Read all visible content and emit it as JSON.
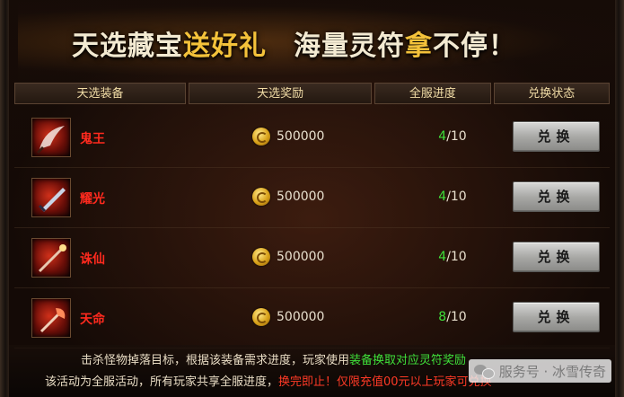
{
  "banner": {
    "part1": "天选藏宝",
    "part2": "送好礼",
    "part3": "海量灵符",
    "part4": "拿",
    "part5": "不停！"
  },
  "table": {
    "headers": [
      "天选装备",
      "天选奖励",
      "全服进度",
      "兑换状态"
    ],
    "rows": [
      {
        "name": "鬼王",
        "icon": "weapon-blade-icon",
        "reward": "500000",
        "progress_current": "4",
        "progress_total": "/10",
        "button": "兑换"
      },
      {
        "name": "耀光",
        "icon": "weapon-sword-icon",
        "reward": "500000",
        "progress_current": "4",
        "progress_total": "/10",
        "button": "兑换"
      },
      {
        "name": "诛仙",
        "icon": "weapon-staff-icon",
        "reward": "500000",
        "progress_current": "4",
        "progress_total": "/10",
        "button": "兑换"
      },
      {
        "name": "天命",
        "icon": "weapon-axe-icon",
        "reward": "500000",
        "progress_current": "8",
        "progress_total": "/10",
        "button": "兑换"
      }
    ]
  },
  "footer": {
    "line1_a": "击杀怪物掉落目标，根据该装备需求进度，玩家使用",
    "line1_b": "装备换取对应灵符奖励",
    "line2_a": "该活动为全服活动，所有玩家共享全服进度，",
    "line2_b": "换完即止！仅限充值00元以上玩家可兑换"
  },
  "watermark": {
    "text": "服务号 · 冰雪传奇"
  },
  "colors": {
    "item_name": "#ff2a1e",
    "progress_current": "#3fe03a",
    "banner_gold": "#f4c23a",
    "banner_white": "#f3ead2"
  }
}
